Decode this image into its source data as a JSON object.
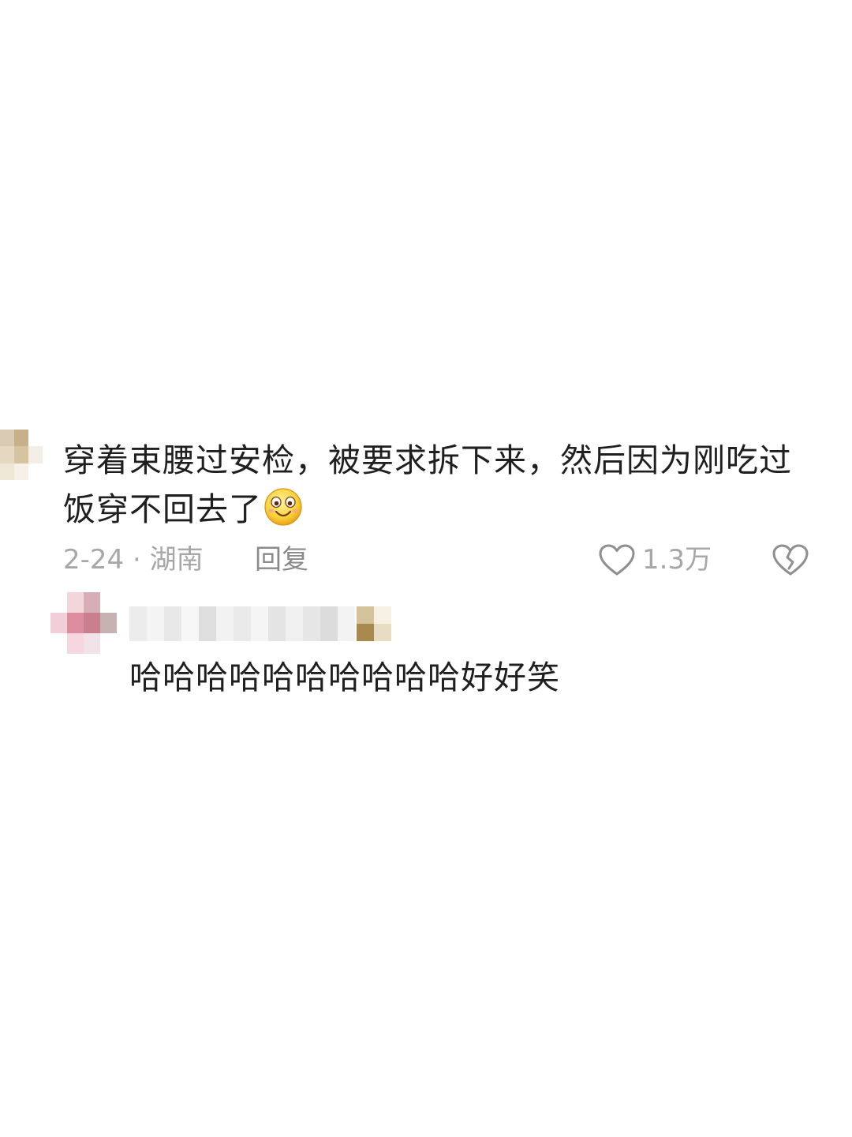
{
  "comment": {
    "avatar_icon": "pixelated-avatar",
    "text": "穿着束腰过安检，被要求拆下来，然后因为刚吃过饭穿不回去了",
    "emoji_icon": "smiling-face-emoji",
    "date_location": "2-24 · 湖南",
    "reply_label": "回复",
    "like_icon": "heart-outline-icon",
    "like_count": "1.3万",
    "dislike_icon": "broken-heart-icon"
  },
  "reply": {
    "avatar_icon": "pixelated-avatar",
    "username_icon": "pixelated-username",
    "text": "哈哈哈哈哈哈哈哈哈哈好好笑"
  }
}
